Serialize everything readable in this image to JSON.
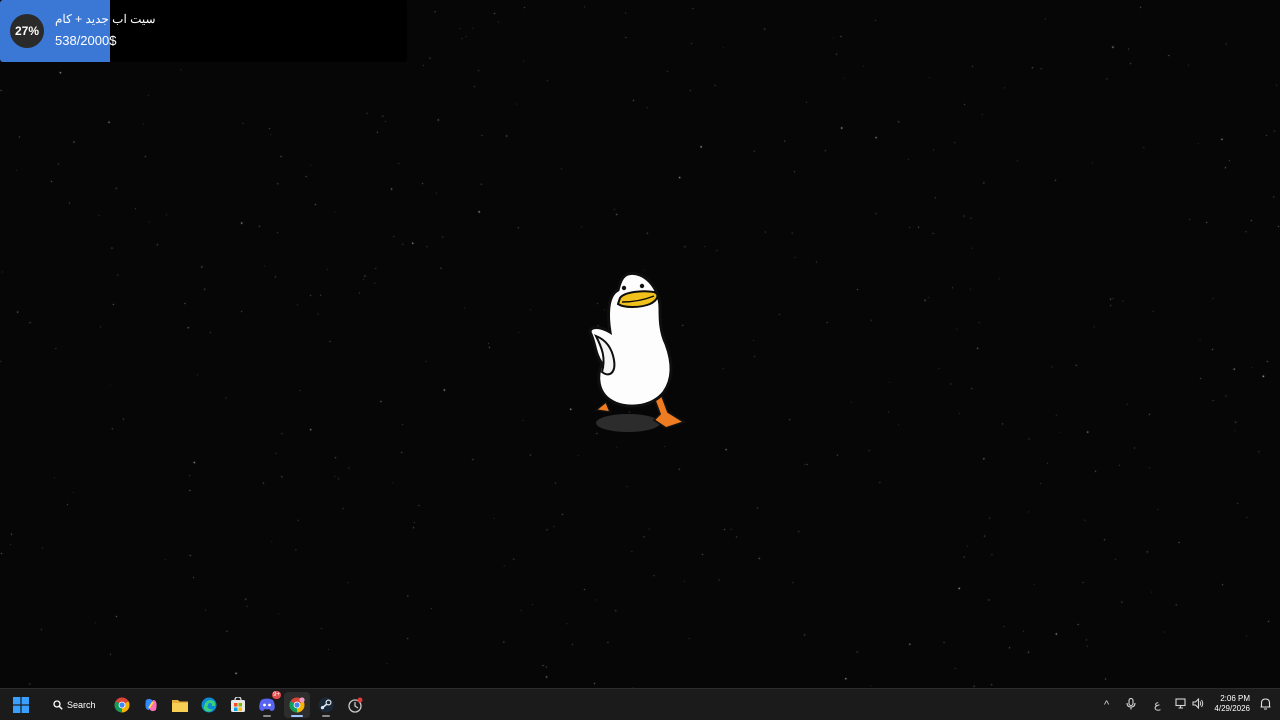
{
  "goal_widget": {
    "percent_label": "27%",
    "title": "سيت اب جديد + كام",
    "amount": "538/2000$",
    "progress": 0.27,
    "fill_color": "#3b78d6"
  },
  "desktop": {
    "background_color": "#060606",
    "mascot": "white-duck"
  },
  "taskbar": {
    "start_icon": "windows-start-icon",
    "search_label": "Search",
    "pinned_apps": [
      {
        "name": "chrome-icon"
      },
      {
        "name": "copilot-icon"
      },
      {
        "name": "file-explorer-icon"
      },
      {
        "name": "edge-icon"
      },
      {
        "name": "microsoft-store-icon"
      },
      {
        "name": "discord-icon",
        "badge": "9+"
      },
      {
        "name": "chrome-profile-icon",
        "active": true
      },
      {
        "name": "steam-icon"
      },
      {
        "name": "app-icon",
        "notification_dot": true
      }
    ],
    "tray": {
      "chevron": "^",
      "mic": "microphone-icon",
      "ime": "ع",
      "network": "network-icon",
      "volume": "volume-icon"
    },
    "clock": {
      "time": "2:06 PM",
      "date": "4/29/2026"
    },
    "notification_icon": "notification-bell-icon"
  }
}
